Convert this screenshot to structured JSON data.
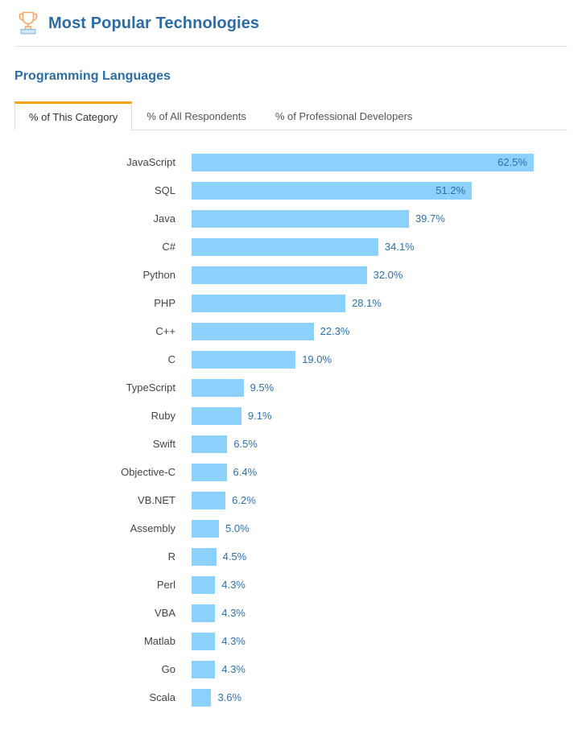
{
  "header": {
    "title": "Most Popular Technologies",
    "icon": "trophy-icon"
  },
  "section": {
    "title": "Programming Languages"
  },
  "tabs": [
    {
      "label": "% of This Category",
      "active": true
    },
    {
      "label": "% of All Respondents",
      "active": false
    },
    {
      "label": "% of Professional Developers",
      "active": false
    }
  ],
  "colors": {
    "bar": "#8bd1fc",
    "title": "#2d6ca2",
    "value_text": "#2f6fa8",
    "tab_accent": "#f0a30a"
  },
  "chart_data": {
    "type": "bar",
    "orientation": "horizontal",
    "title": "Programming Languages",
    "xlabel": "",
    "ylabel": "",
    "xlim": [
      0,
      66
    ],
    "grid": false,
    "legend": null,
    "value_suffix": "%",
    "categories": [
      "JavaScript",
      "SQL",
      "Java",
      "C#",
      "Python",
      "PHP",
      "C++",
      "C",
      "TypeScript",
      "Ruby",
      "Swift",
      "Objective-C",
      "VB.NET",
      "Assembly",
      "R",
      "Perl",
      "VBA",
      "Matlab",
      "Go",
      "Scala"
    ],
    "values": [
      62.5,
      51.2,
      39.7,
      34.1,
      32.0,
      28.1,
      22.3,
      19.0,
      9.5,
      9.1,
      6.5,
      6.4,
      6.2,
      5.0,
      4.5,
      4.3,
      4.3,
      4.3,
      4.3,
      3.6
    ],
    "labels": [
      "62.5%",
      "51.2%",
      "39.7%",
      "34.1%",
      "32.0%",
      "28.1%",
      "22.3%",
      "19.0%",
      "9.5%",
      "9.1%",
      "6.5%",
      "6.4%",
      "6.2%",
      "5.0%",
      "4.5%",
      "4.3%",
      "4.3%",
      "4.3%",
      "4.3%",
      "3.6%"
    ]
  }
}
